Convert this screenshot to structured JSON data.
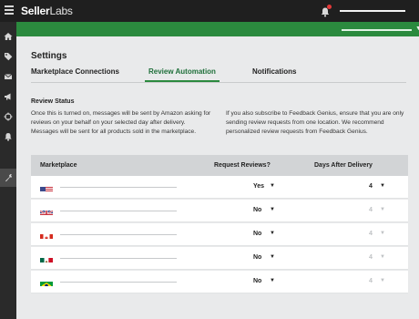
{
  "app": {
    "brand_main": "Seller",
    "brand_sub": "Labs"
  },
  "colors": {
    "accent": "#2b8a3e",
    "topbar": "#1f1f1f",
    "sidebar": "#2a2a2a",
    "notification_dot": "#e53a3a"
  },
  "sidebar": {
    "icons": [
      "home-icon",
      "tag-icon",
      "mail-icon",
      "megaphone-icon",
      "target-icon",
      "bell-icon",
      "settings-icon"
    ],
    "active": "settings-icon"
  },
  "page": {
    "title": "Settings"
  },
  "tabs": [
    {
      "label": "Marketplace Connections",
      "active": false
    },
    {
      "label": "Review Automation",
      "active": true
    },
    {
      "label": "Notifications",
      "active": false
    }
  ],
  "review_status": {
    "title": "Review Status",
    "left_text": "Once this is turned on, messages will be sent by Amazon asking for reviews on your behalf on your selected day after delivery. Messages will be sent for all products sold in the marketplace.",
    "right_text": "If you also subscribe to Feedback Genius, ensure that you are only sending review requests from one location. We recommend personalized review requests from Feedback Genius."
  },
  "table": {
    "headers": {
      "marketplace": "Marketplace",
      "request": "Request Reviews?",
      "days": "Days After Delivery"
    },
    "rows": [
      {
        "flag": "us-flag-icon",
        "request": "Yes",
        "days": "4",
        "days_enabled": true
      },
      {
        "flag": "uk-flag-icon",
        "request": "No",
        "days": "4",
        "days_enabled": false
      },
      {
        "flag": "canada-flag-icon",
        "request": "No",
        "days": "4",
        "days_enabled": false
      },
      {
        "flag": "mexico-flag-icon",
        "request": "No",
        "days": "4",
        "days_enabled": false
      },
      {
        "flag": "brazil-flag-icon",
        "request": "No",
        "days": "4",
        "days_enabled": false
      }
    ]
  }
}
